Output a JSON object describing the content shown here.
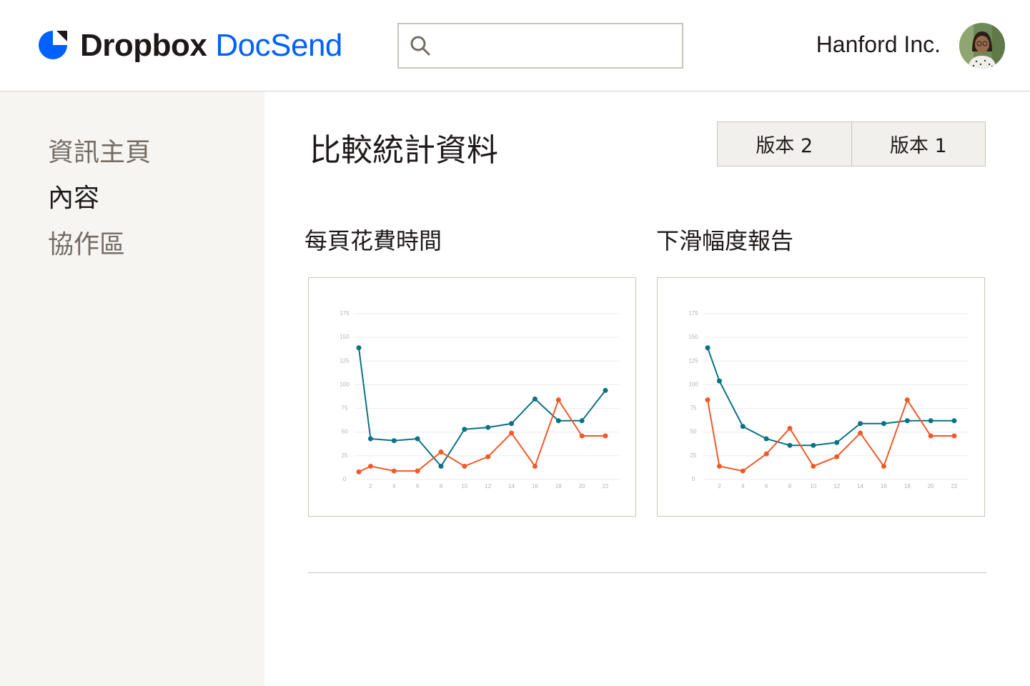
{
  "header": {
    "brand_main": "Dropbox",
    "brand_sub": "DocSend",
    "search": {
      "value": "",
      "placeholder": ""
    },
    "company": "Hanford Inc."
  },
  "sidebar": {
    "items": [
      {
        "label": "資訊主頁",
        "active": false
      },
      {
        "label": "內容",
        "active": true
      },
      {
        "label": "協作區",
        "active": false
      }
    ]
  },
  "main": {
    "title": "比較統計資料",
    "version_buttons": [
      "版本 2",
      "版本 1"
    ],
    "charts": [
      {
        "title": "每頁花費時間"
      },
      {
        "title": "下滑幅度報告"
      }
    ]
  },
  "colors": {
    "brand_blue": "#0061fe",
    "series_teal": "#0b7285",
    "series_orange": "#f05a28",
    "sidebar_bg": "#f7f5f2",
    "border": "#c9c5ba"
  },
  "icons": {
    "logo": "dropbox-logo-icon",
    "search": "search-icon"
  },
  "chart_data": [
    {
      "type": "line",
      "title": "每頁花費時間",
      "x": [
        1,
        2,
        3,
        4,
        5,
        6,
        7,
        8,
        9,
        10,
        11,
        12,
        13,
        14,
        15,
        16,
        17,
        18,
        19,
        20,
        21,
        22
      ],
      "xticks": [
        2,
        4,
        6,
        8,
        10,
        12,
        14,
        16,
        18,
        20,
        22
      ],
      "yticks": [
        0,
        25,
        50,
        75,
        100,
        125,
        150,
        175
      ],
      "ylim": [
        0,
        175
      ],
      "grid": true,
      "series": [
        {
          "color": "#0b7285",
          "points": [
            [
              1,
              139
            ],
            [
              2,
              43
            ],
            [
              4,
              41
            ],
            [
              6,
              43
            ],
            [
              8,
              14
            ],
            [
              10,
              53
            ],
            [
              12,
              55
            ],
            [
              14,
              59
            ],
            [
              16,
              85
            ],
            [
              18,
              62
            ],
            [
              20,
              62
            ],
            [
              22,
              94
            ]
          ]
        },
        {
          "color": "#f05a28",
          "points": [
            [
              1,
              8
            ],
            [
              2,
              14
            ],
            [
              4,
              9
            ],
            [
              6,
              9
            ],
            [
              8,
              29
            ],
            [
              10,
              14
            ],
            [
              12,
              24
            ],
            [
              14,
              49
            ],
            [
              16,
              14
            ],
            [
              18,
              84
            ],
            [
              20,
              46
            ],
            [
              22,
              46
            ]
          ]
        }
      ]
    },
    {
      "type": "line",
      "title": "下滑幅度報告",
      "x": [
        1,
        2,
        3,
        4,
        5,
        6,
        7,
        8,
        9,
        10,
        11,
        12,
        13,
        14,
        15,
        16,
        17,
        18,
        19,
        20,
        21,
        22
      ],
      "xticks": [
        2,
        4,
        6,
        8,
        10,
        12,
        14,
        16,
        18,
        20,
        22
      ],
      "yticks": [
        0,
        25,
        50,
        75,
        100,
        125,
        150,
        175
      ],
      "ylim": [
        0,
        175
      ],
      "grid": true,
      "series": [
        {
          "color": "#0b7285",
          "points": [
            [
              1,
              139
            ],
            [
              2,
              104
            ],
            [
              4,
              56
            ],
            [
              6,
              43
            ],
            [
              8,
              36
            ],
            [
              10,
              36
            ],
            [
              12,
              39
            ],
            [
              14,
              59
            ],
            [
              16,
              59
            ],
            [
              18,
              62
            ],
            [
              20,
              62
            ],
            [
              22,
              62
            ]
          ]
        },
        {
          "color": "#f05a28",
          "points": [
            [
              1,
              84
            ],
            [
              2,
              14
            ],
            [
              4,
              9
            ],
            [
              6,
              27
            ],
            [
              8,
              54
            ],
            [
              10,
              14
            ],
            [
              12,
              24
            ],
            [
              14,
              49
            ],
            [
              16,
              14
            ],
            [
              18,
              84
            ],
            [
              20,
              46
            ],
            [
              22,
              46
            ]
          ]
        }
      ]
    }
  ]
}
